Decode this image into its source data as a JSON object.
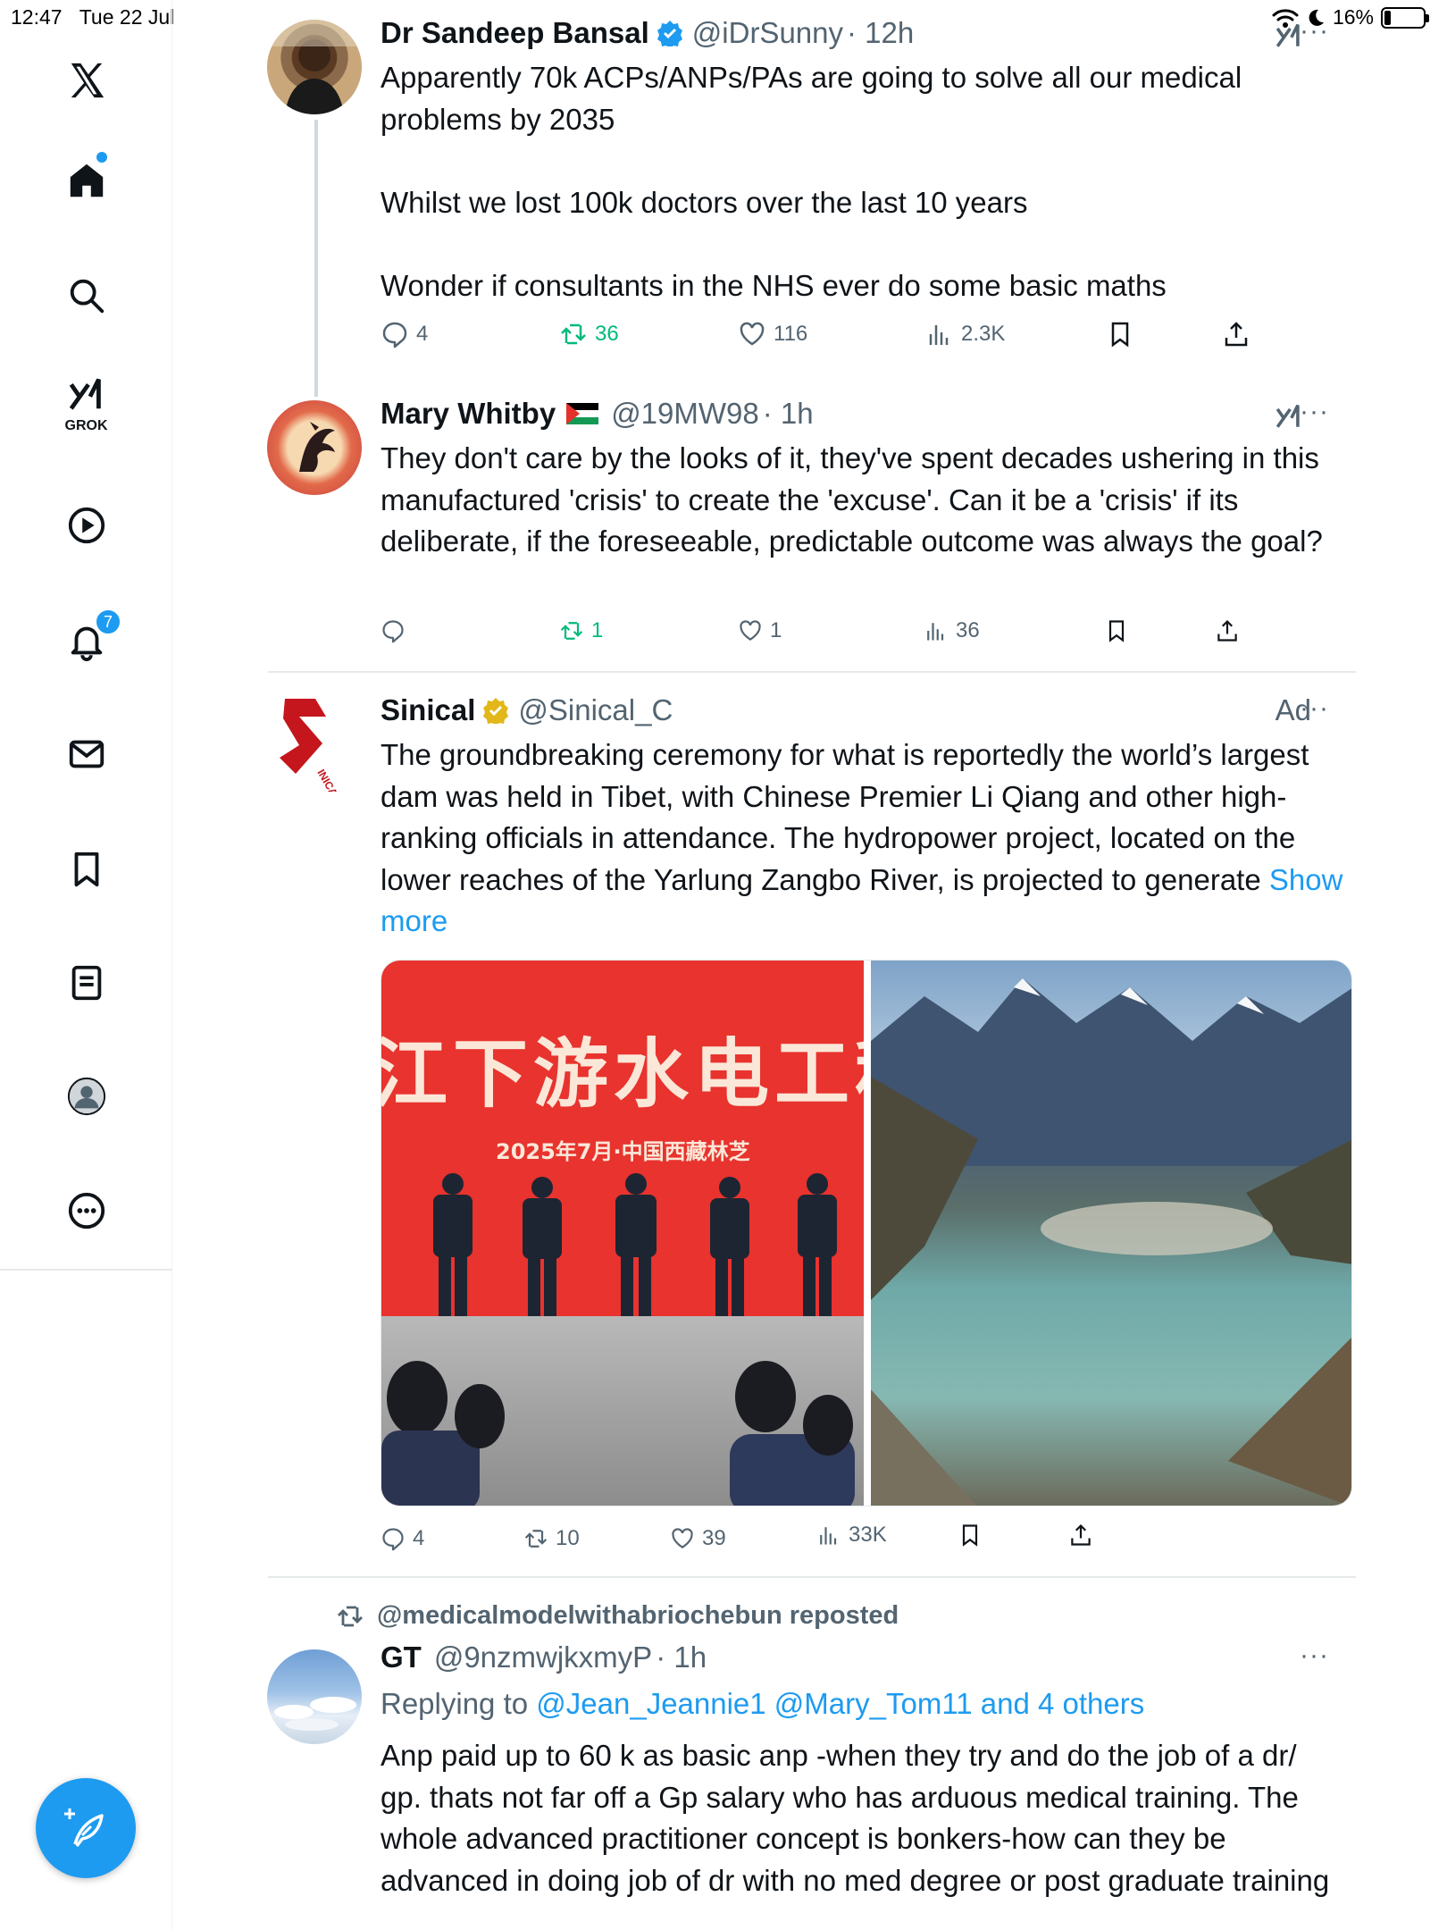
{
  "status_bar": {
    "time": "12:47",
    "date": "Tue 22 Jul",
    "battery": "16%",
    "battery_level": 0.16
  },
  "sidebar": {
    "grok_label": "GROK",
    "notifications_badge": "7"
  },
  "colors": {
    "accent": "#1d9bf0",
    "retweet_green": "#00ba7c",
    "secondary_text": "#536471"
  },
  "tweets": [
    {
      "name": "Dr Sandeep Bansal",
      "handle": "@iDrSunny",
      "time": "· 12h",
      "verified": "blue",
      "paragraphs": [
        "Apparently 70k ACPs/ANPs/PAs are going to solve all our medical problems by 2035",
        "Whilst we lost 100k doctors over the last 10 years",
        "Wonder if consultants in the NHS ever do some basic maths"
      ],
      "stats": {
        "replies": "4",
        "reposts": "36",
        "likes": "116",
        "views": "2.3K"
      }
    },
    {
      "name": "Mary Whitby",
      "flag": "🇵🇸",
      "handle": "@19MW98",
      "time": "· 1h",
      "paragraphs": [
        "They don't care by the looks of it, they've spent decades ushering in this manufactured 'crisis' to create the 'excuse'. Can it be a 'crisis' if its deliberate, if the foreseeable, predictable outcome was always the goal?"
      ],
      "stats": {
        "replies": "",
        "reposts": "1",
        "likes": "1",
        "views": "36"
      }
    },
    {
      "name": "Sinical",
      "handle": "@Sinical_C",
      "ad_label": "Ad",
      "verified": "gold",
      "paragraphs": [
        "The groundbreaking ceremony for what is reportedly the world’s largest dam was held in Tibet, with Chinese Premier Li Qiang and other high-ranking officials in attendance. The hydropower project, located on the lower reaches of the Yarlung Zangbo River, is projected to generate"
      ],
      "show_more": "Show more",
      "avatar_text": "INICAL HINA",
      "image_banner": "江下游水电工程",
      "image_subbanner": "2025年7月·中国西藏林芝",
      "stats": {
        "replies": "4",
        "reposts": "10",
        "likes": "39",
        "views": "33K"
      }
    },
    {
      "repost_label": "@medicalmodelwithabriochebun reposted",
      "name": "GT",
      "handle": "@9nzmwjkxmyP",
      "time": "· 1h",
      "replying_prefix": "Replying to",
      "replying_to": "@Jean_Jeannie1 @Mary_Tom11 and 4 others",
      "paragraphs": [
        "Anp paid up to 60 k as basic anp -when they try and do the job of a dr/ gp. thats not far off a Gp salary who has arduous medical training. The whole advanced practitioner concept is bonkers-how can they be advanced in doing job of dr with no med degree or post graduate training"
      ]
    }
  ]
}
